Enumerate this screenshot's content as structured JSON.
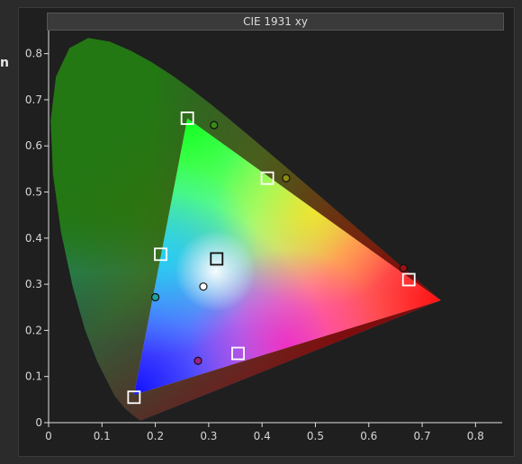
{
  "clipped_label": "n",
  "chart_data": {
    "type": "scatter",
    "title": "CIE 1931 xy",
    "xlabel": "",
    "ylabel": "",
    "xlim": [
      0,
      0.85
    ],
    "ylim": [
      0,
      0.85
    ],
    "xticks": [
      0,
      0.1,
      0.2,
      0.3,
      0.4,
      0.5,
      0.6,
      0.7,
      0.8
    ],
    "yticks": [
      0,
      0.1,
      0.2,
      0.3,
      0.4,
      0.5,
      0.6,
      0.7,
      0.8
    ],
    "xtick_labels": [
      "0",
      "0.1",
      "0.2",
      "0.3",
      "0.4",
      "0.5",
      "0.6",
      "0.7",
      "0.8"
    ],
    "ytick_labels": [
      "0",
      "0.1",
      "0.2",
      "0.3",
      "0.4",
      "0.5",
      "0.6",
      "0.7",
      "0.8"
    ],
    "grid": false,
    "gamut_triangle": [
      [
        0.735,
        0.265
      ],
      [
        0.26,
        0.66
      ],
      [
        0.16,
        0.06
      ]
    ],
    "target_markers": [
      {
        "x": 0.675,
        "y": 0.31
      },
      {
        "x": 0.26,
        "y": 0.66
      },
      {
        "x": 0.16,
        "y": 0.055
      },
      {
        "x": 0.41,
        "y": 0.53
      },
      {
        "x": 0.21,
        "y": 0.365
      },
      {
        "x": 0.355,
        "y": 0.15
      },
      {
        "x": 0.315,
        "y": 0.355
      }
    ],
    "measured_points": [
      {
        "x": 0.665,
        "y": 0.335,
        "color": "#a01010"
      },
      {
        "x": 0.31,
        "y": 0.645,
        "color": "#3a8a1a"
      },
      {
        "x": 0.445,
        "y": 0.53,
        "color": "#8a8a10"
      },
      {
        "x": 0.2,
        "y": 0.272,
        "color": "#20a0a0"
      },
      {
        "x": 0.28,
        "y": 0.134,
        "color": "#a0208a"
      },
      {
        "x": 0.29,
        "y": 0.295,
        "color": "#ffffff"
      }
    ]
  }
}
